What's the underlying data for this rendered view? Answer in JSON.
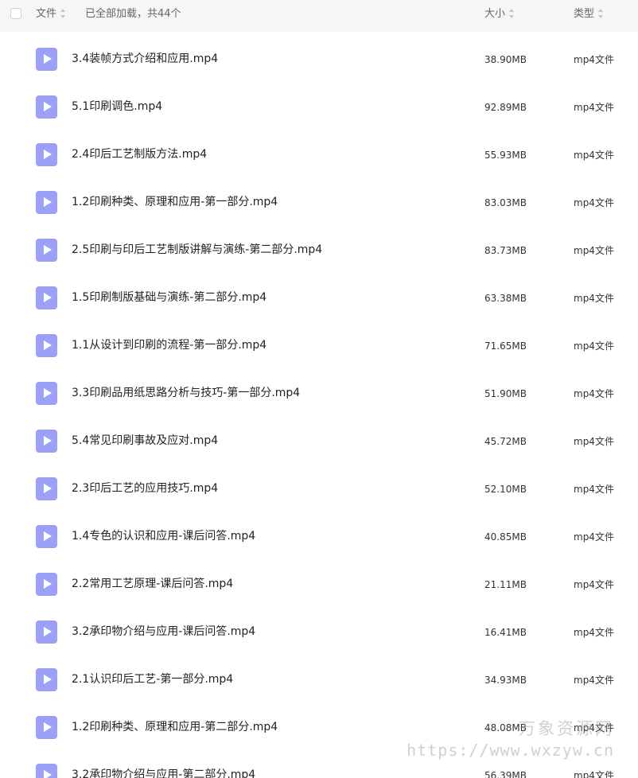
{
  "header": {
    "file_label": "文件",
    "load_status": "已全部加载，共44个",
    "size_label": "大小",
    "type_label": "类型"
  },
  "files": [
    {
      "name": "3.4装帧方式介绍和应用.mp4",
      "size": "38.90MB",
      "type": "mp4文件"
    },
    {
      "name": "5.1印刷调色.mp4",
      "size": "92.89MB",
      "type": "mp4文件"
    },
    {
      "name": "2.4印后工艺制版方法.mp4",
      "size": "55.93MB",
      "type": "mp4文件"
    },
    {
      "name": "1.2印刷种类、原理和应用-第一部分.mp4",
      "size": "83.03MB",
      "type": "mp4文件"
    },
    {
      "name": "2.5印刷与印后工艺制版讲解与演练-第二部分.mp4",
      "size": "83.73MB",
      "type": "mp4文件"
    },
    {
      "name": "1.5印刷制版基础与演练-第二部分.mp4",
      "size": "63.38MB",
      "type": "mp4文件"
    },
    {
      "name": "1.1从设计到印刷的流程-第一部分.mp4",
      "size": "71.65MB",
      "type": "mp4文件"
    },
    {
      "name": "3.3印刷品用纸思路分析与技巧-第一部分.mp4",
      "size": "51.90MB",
      "type": "mp4文件"
    },
    {
      "name": "5.4常见印刷事故及应对.mp4",
      "size": "45.72MB",
      "type": "mp4文件"
    },
    {
      "name": "2.3印后工艺的应用技巧.mp4",
      "size": "52.10MB",
      "type": "mp4文件"
    },
    {
      "name": "1.4专色的认识和应用-课后问答.mp4",
      "size": "40.85MB",
      "type": "mp4文件"
    },
    {
      "name": "2.2常用工艺原理-课后问答.mp4",
      "size": "21.11MB",
      "type": "mp4文件"
    },
    {
      "name": "3.2承印物介绍与应用-课后问答.mp4",
      "size": "16.41MB",
      "type": "mp4文件"
    },
    {
      "name": "2.1认识印后工艺-第一部分.mp4",
      "size": "34.93MB",
      "type": "mp4文件"
    },
    {
      "name": "1.2印刷种类、原理和应用-第二部分.mp4",
      "size": "48.08MB",
      "type": "mp4文件"
    },
    {
      "name": "3.2承印物介绍与应用-第二部分.mp4",
      "size": "56.39MB",
      "type": "mp4文件"
    }
  ],
  "watermark": {
    "title": "万象资源网",
    "url": "https://www.wxzyw.cn"
  },
  "colors": {
    "header_bg": "#f5f6f8",
    "video_icon": "#9da0f7"
  }
}
